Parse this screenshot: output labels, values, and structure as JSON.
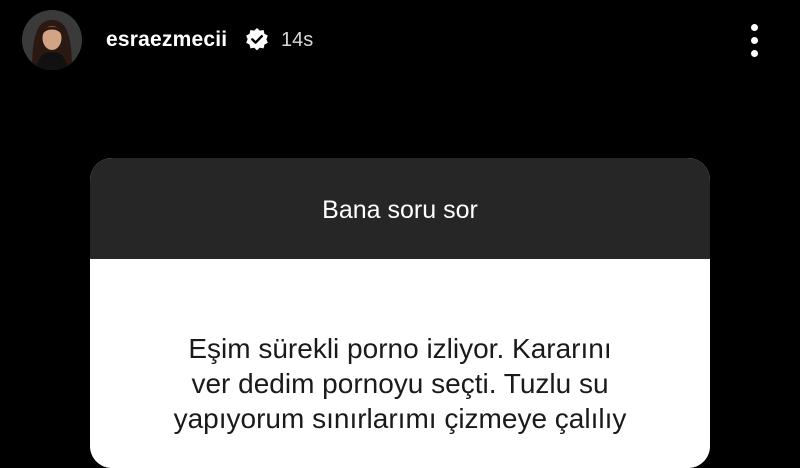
{
  "story": {
    "username": "esraezmecii",
    "timestamp": "14s",
    "verified": true,
    "icons": {
      "avatar": "profile-avatar",
      "verified": "verified-badge-icon",
      "more": "more-vertical-icon"
    }
  },
  "question_sticker": {
    "prompt": "Bana soru sor",
    "answer_text": "Eşim sürekli porno izliyor. Kararını\nver dedim pornoyu seçti. Tuzlu su\nyapıyorum sınırlarımı çizmeye çalılıy"
  },
  "colors": {
    "background": "#000000",
    "card_header": "#262626",
    "card_body": "#ffffff",
    "text_dark": "#1a1a1a"
  }
}
